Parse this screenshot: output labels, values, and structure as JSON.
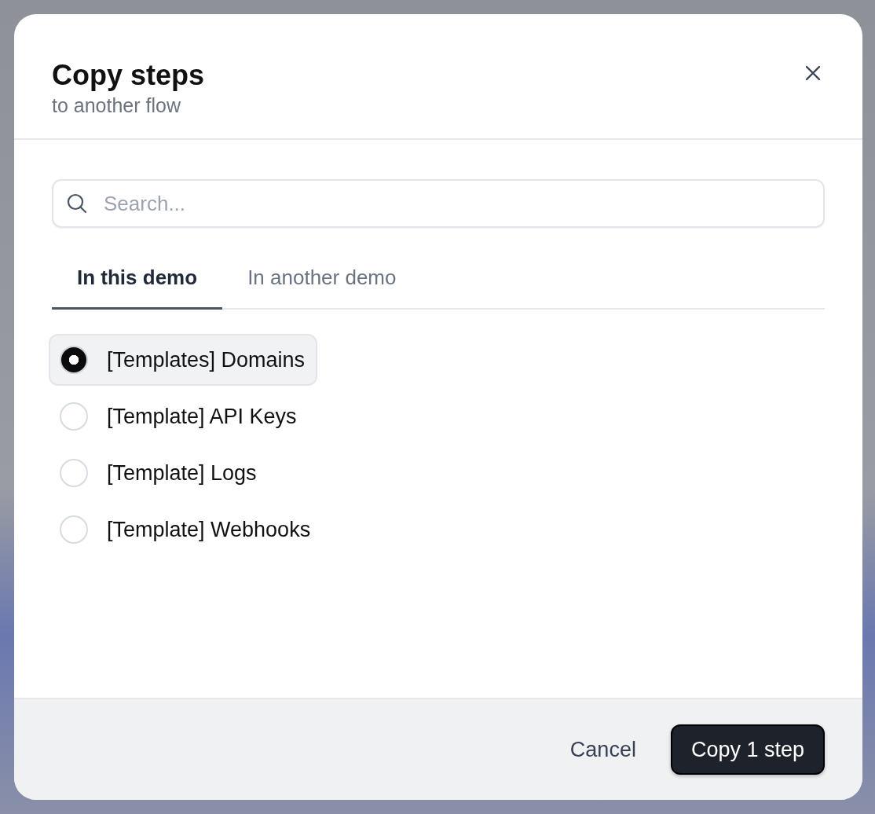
{
  "dialog": {
    "title": "Copy steps",
    "subtitle": "to another flow"
  },
  "search": {
    "placeholder": "Search..."
  },
  "tabs": [
    {
      "label": "In this demo",
      "selected": true
    },
    {
      "label": "In another demo",
      "selected": false
    }
  ],
  "flows": [
    {
      "label": "[Templates] Domains",
      "selected": true
    },
    {
      "label": "[Template] API Keys",
      "selected": false
    },
    {
      "label": "[Template] Logs",
      "selected": false
    },
    {
      "label": "[Template] Webhooks",
      "selected": false
    }
  ],
  "buttons": {
    "cancel": "Cancel",
    "confirm": "Copy 1 step"
  }
}
